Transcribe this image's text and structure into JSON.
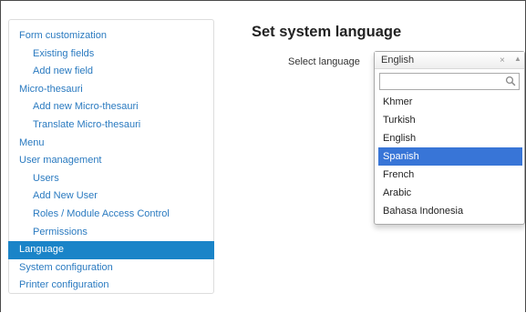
{
  "sidebar": {
    "items": [
      {
        "label": "Form customization",
        "level": 0,
        "active": false
      },
      {
        "label": "Existing fields",
        "level": 1,
        "active": false
      },
      {
        "label": "Add new field",
        "level": 1,
        "active": false
      },
      {
        "label": "Micro-thesauri",
        "level": 0,
        "active": false
      },
      {
        "label": "Add new Micro-thesauri",
        "level": 1,
        "active": false
      },
      {
        "label": "Translate Micro-thesauri",
        "level": 1,
        "active": false
      },
      {
        "label": "Menu",
        "level": 0,
        "active": false
      },
      {
        "label": "User management",
        "level": 0,
        "active": false
      },
      {
        "label": "Users",
        "level": 1,
        "active": false
      },
      {
        "label": "Add New User",
        "level": 1,
        "active": false
      },
      {
        "label": "Roles / Module Access Control",
        "level": 1,
        "active": false
      },
      {
        "label": "Permissions",
        "level": 1,
        "active": false
      },
      {
        "label": "Language",
        "level": 0,
        "active": true
      },
      {
        "label": "System configuration",
        "level": 0,
        "active": false
      },
      {
        "label": "Printer configuration",
        "level": 0,
        "active": false
      }
    ]
  },
  "main": {
    "title": "Set system language",
    "select_label": "Select language"
  },
  "language_select": {
    "selected": "English",
    "clear_symbol": "×",
    "arrow_symbol": "▲",
    "search_value": "",
    "options": [
      "Khmer",
      "Turkish",
      "English",
      "Spanish",
      "French",
      "Arabic",
      "Bahasa Indonesia"
    ],
    "highlighted": "Spanish"
  },
  "colors": {
    "link": "#2a7ac0",
    "active_bg": "#1a84c8",
    "highlight_bg": "#3875d7"
  },
  "icons": {
    "search": "search-icon",
    "clear": "close-icon",
    "arrow": "chevron-up-icon"
  }
}
